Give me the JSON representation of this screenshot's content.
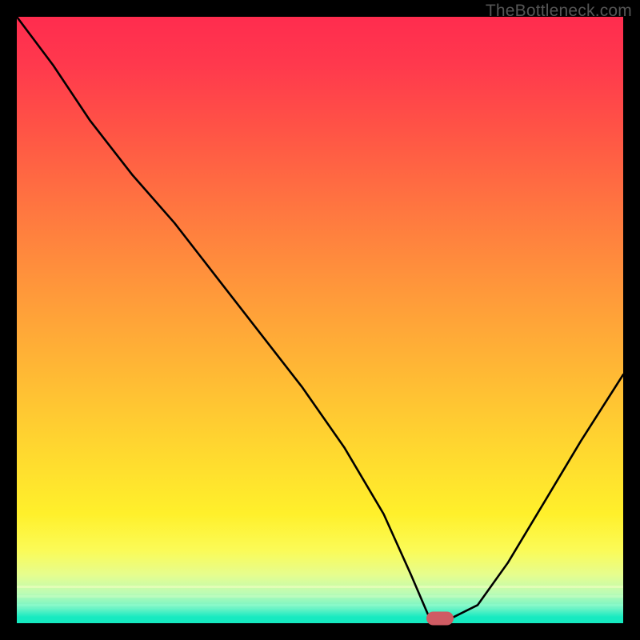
{
  "watermark": "TheBottleneck.com",
  "marker": {
    "x_frac": 0.698,
    "y_frac": 0.992
  },
  "colors": {
    "frame": "#000000",
    "marker": "#cf5b63",
    "curve": "#000000",
    "gradient_top": "#ff2c4e",
    "gradient_bottom": "#16eac1"
  },
  "chart_data": {
    "type": "line",
    "title": "",
    "xlabel": "",
    "ylabel": "",
    "xlim": [
      0,
      1
    ],
    "ylim": [
      0,
      1
    ],
    "grid": false,
    "legend": false,
    "background": "red-yellow-green vertical gradient",
    "series": [
      {
        "name": "bottleneck-curve",
        "x": [
          0.0,
          0.06,
          0.12,
          0.19,
          0.26,
          0.33,
          0.4,
          0.47,
          0.54,
          0.605,
          0.65,
          0.68,
          0.72,
          0.76,
          0.81,
          0.87,
          0.93,
          1.0
        ],
        "y": [
          1.0,
          0.92,
          0.83,
          0.74,
          0.66,
          0.57,
          0.48,
          0.39,
          0.29,
          0.18,
          0.08,
          0.01,
          0.01,
          0.03,
          0.1,
          0.2,
          0.3,
          0.41
        ]
      }
    ],
    "annotations": [
      {
        "type": "pill",
        "x": 0.698,
        "y": 0.008,
        "color": "#cf5b63",
        "meaning": "optimal / minimum point marker"
      }
    ]
  }
}
